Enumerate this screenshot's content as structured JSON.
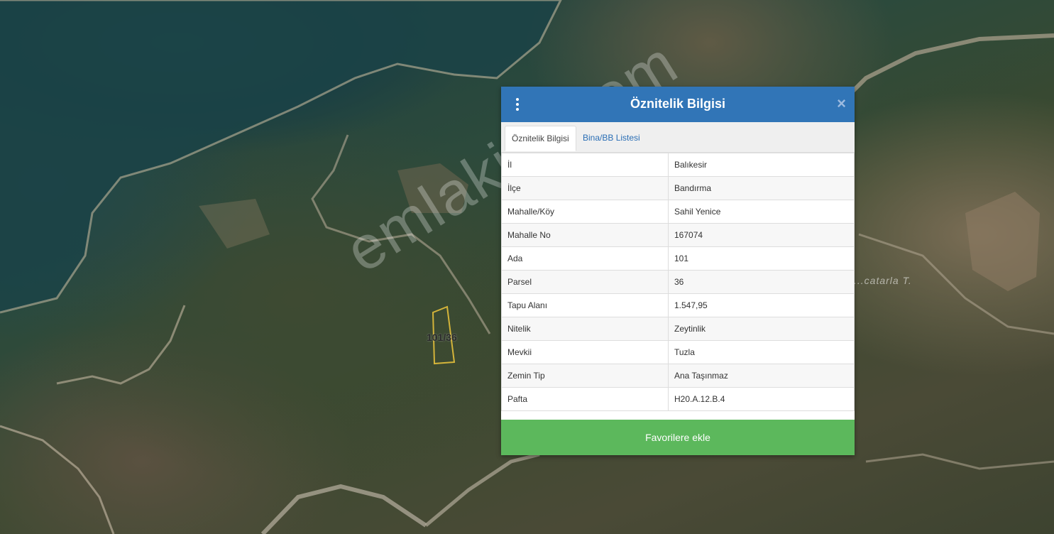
{
  "map": {
    "parcel_label": "101/36",
    "place_label": "...catarla T.",
    "watermark": "emlakjet.com"
  },
  "dialog": {
    "title": "Öznitelik Bilgisi",
    "menu_icon": "vertical-dots-icon",
    "close_icon": "close-icon",
    "close_symbol": "×",
    "tabs": [
      {
        "label": "Öznitelik Bilgisi",
        "active": true
      },
      {
        "label": "Bina/BB Listesi",
        "active": false
      }
    ],
    "rows": [
      {
        "key": "İl",
        "value": "Balıkesir"
      },
      {
        "key": "İlçe",
        "value": "Bandırma"
      },
      {
        "key": "Mahalle/Köy",
        "value": "Sahil Yenice"
      },
      {
        "key": "Mahalle No",
        "value": "167074"
      },
      {
        "key": "Ada",
        "value": "101"
      },
      {
        "key": "Parsel",
        "value": "36"
      },
      {
        "key": "Tapu Alanı",
        "value": "1.547,95"
      },
      {
        "key": "Nitelik",
        "value": "Zeytinlik"
      },
      {
        "key": "Mevkii",
        "value": "Tuzla"
      },
      {
        "key": "Zemin Tip",
        "value": "Ana Taşınmaz"
      },
      {
        "key": "Pafta",
        "value": "H20.A.12.B.4"
      }
    ],
    "favorite_button": "Favorilere ekle"
  },
  "colors": {
    "header": "#3175b7",
    "button": "#5cb85c",
    "tab_link": "#2a6eb5",
    "parcel_outline": "#d4b43a"
  }
}
